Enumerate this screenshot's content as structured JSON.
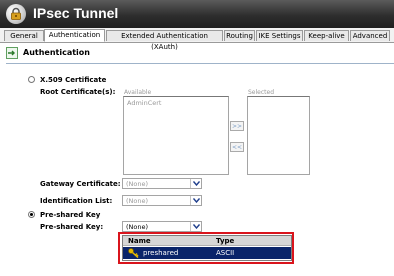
{
  "window": {
    "title": "IPsec Tunnel",
    "icon": "lock-icon"
  },
  "tabs": [
    {
      "label": "General",
      "active": false
    },
    {
      "label": "Authentication",
      "active": true
    },
    {
      "label": "Extended Authentication (XAuth)",
      "active": false
    },
    {
      "label": "Routing",
      "active": false
    },
    {
      "label": "IKE Settings",
      "active": false
    },
    {
      "label": "Keep-alive",
      "active": false
    },
    {
      "label": "Advanced",
      "active": false
    }
  ],
  "section": {
    "title": "Authentication",
    "icon": "key-arrow-icon"
  },
  "x509": {
    "option_label": "X.509 Certificate",
    "root_label": "Root Certificate(s):",
    "available_header": "Available",
    "selected_header": "Selected",
    "available_items": [
      "AdminCert"
    ],
    "add_label": ">>",
    "remove_label": "<<",
    "gateway_label": "Gateway Certificate:",
    "gateway_value": "(None)",
    "identification_label": "Identification List:",
    "identification_value": "(None)"
  },
  "psk": {
    "option_label": "Pre-shared Key",
    "key_label": "Pre-shared Key:",
    "key_value": "(None)",
    "popup": {
      "col_name": "Name",
      "col_type": "Type",
      "rows": [
        {
          "name": "preshared",
          "type": "ASCII",
          "icon": "key-icon"
        }
      ]
    }
  },
  "colors": {
    "title_bar": "#2e2e2e",
    "selection": "#0a246a",
    "highlight": "#d9141c"
  }
}
